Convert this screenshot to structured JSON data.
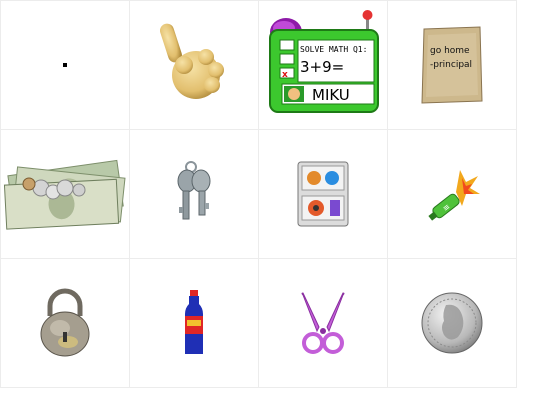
{
  "inventory": {
    "items": [
      {
        "icon": "dot-icon"
      },
      {
        "icon": "pointing-hand-icon"
      },
      {
        "icon": "math-device-icon",
        "prompt": "SOLVE MATH Q1:",
        "equation": "3+9=",
        "name": "MIKU"
      },
      {
        "icon": "note-paper-icon",
        "line1": "go home",
        "line2": "-principal"
      },
      {
        "icon": "money-pile-icon"
      },
      {
        "icon": "keys-icon"
      },
      {
        "icon": "tape-icon"
      },
      {
        "icon": "firework-bottle-icon"
      },
      {
        "icon": "padlock-icon"
      },
      {
        "icon": "soda-bottle-icon"
      },
      {
        "icon": "scissors-icon"
      },
      {
        "icon": "quarter-coin-icon"
      }
    ]
  },
  "colors": {
    "device_green": "#3cc82e",
    "device_screen": "#ffffff",
    "hand_yellow": "#e7c77a",
    "paper_tan": "#c9b58a",
    "scissors_pink": "#c35ed8",
    "soda_blue": "#1f2fb5",
    "soda_red": "#e02626"
  }
}
